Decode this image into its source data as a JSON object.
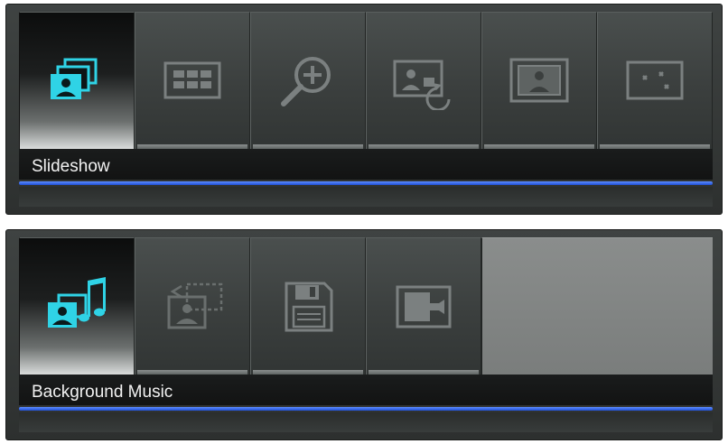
{
  "panels": [
    {
      "label": "Slideshow",
      "icons": [
        "slideshow-icon",
        "thumbnail-grid-icon",
        "zoom-in-icon",
        "rotate-photo-icon",
        "photo-frame-icon",
        "fit-screen-icon"
      ],
      "selected_index": 0
    },
    {
      "label": "Background Music",
      "icons": [
        "background-music-icon",
        "transition-icon",
        "save-disk-icon",
        "exit-icon"
      ],
      "selected_index": 0
    }
  ],
  "colors": {
    "accent": "#2fd3e6",
    "highlight_line": "#3b6cf0",
    "inactive_icon": "#7b8080"
  }
}
